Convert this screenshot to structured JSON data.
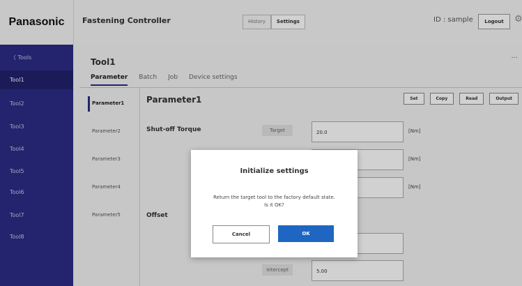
{
  "header": {
    "brand": "Panasonic",
    "app_title": "Fastening Controller",
    "tabs": [
      "History",
      "Settings"
    ],
    "user_id": "ID : sample",
    "logout_label": "Logout"
  },
  "sidebar": {
    "back_label": "Tools",
    "items": [
      "Tool1",
      "Tool2",
      "Tool3",
      "Tool4",
      "Tool5",
      "Tool6",
      "Tool7",
      "Tool8"
    ]
  },
  "main": {
    "tool_title": "Tool1",
    "more": "...",
    "tabs": [
      "Parameter",
      "Batch",
      "Job",
      "Device settings"
    ],
    "params": [
      "Parameter1",
      "Parameter2",
      "Parameter3",
      "Parameter4",
      "Parameter5"
    ],
    "param_title": "Parameter1",
    "actions": [
      "Set",
      "Copy",
      "Read",
      "Output"
    ],
    "shutoff": {
      "label": "Shut-off Torque",
      "target_label": "Target",
      "target_value": "20.0",
      "unit1": "[Nm]",
      "unit2": "[Nm]",
      "unit3": "[Nm]"
    },
    "offset": {
      "label": "Offset",
      "intercept_label": "Intercept",
      "intercept_value": "5.00"
    }
  },
  "dialog": {
    "title": "Initialize settings",
    "message_line1": "Return the target tool to the factory default state.",
    "message_line2": "Is it OK?",
    "cancel_label": "Cancel",
    "ok_label": "OK"
  }
}
